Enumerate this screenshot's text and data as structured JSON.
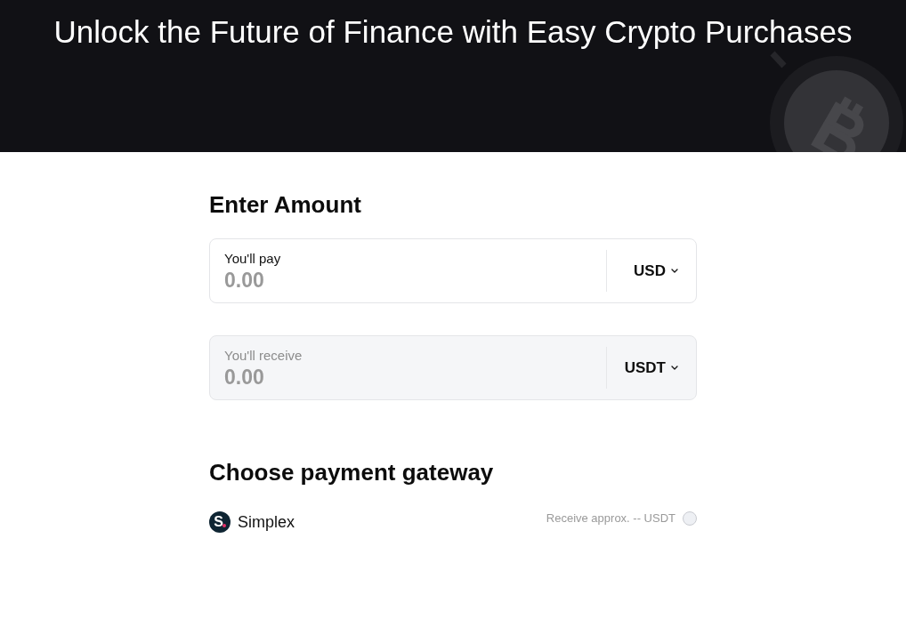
{
  "header": {
    "title": "Unlock the Future of Finance with Easy Crypto Purchases"
  },
  "amount_section": {
    "heading": "Enter Amount",
    "fields": [
      {
        "label": "You'll pay",
        "placeholder": "0.00",
        "currency": "USD",
        "disabled": false
      },
      {
        "label": "You'll receive",
        "placeholder": "0.00",
        "currency": "USDT",
        "disabled": true
      }
    ]
  },
  "gateway_section": {
    "heading": "Choose payment gateway",
    "options": [
      {
        "logo_letter": "S",
        "name": "Simplex",
        "estimate": "Receive approx. -- USDT",
        "selected": false
      }
    ]
  }
}
